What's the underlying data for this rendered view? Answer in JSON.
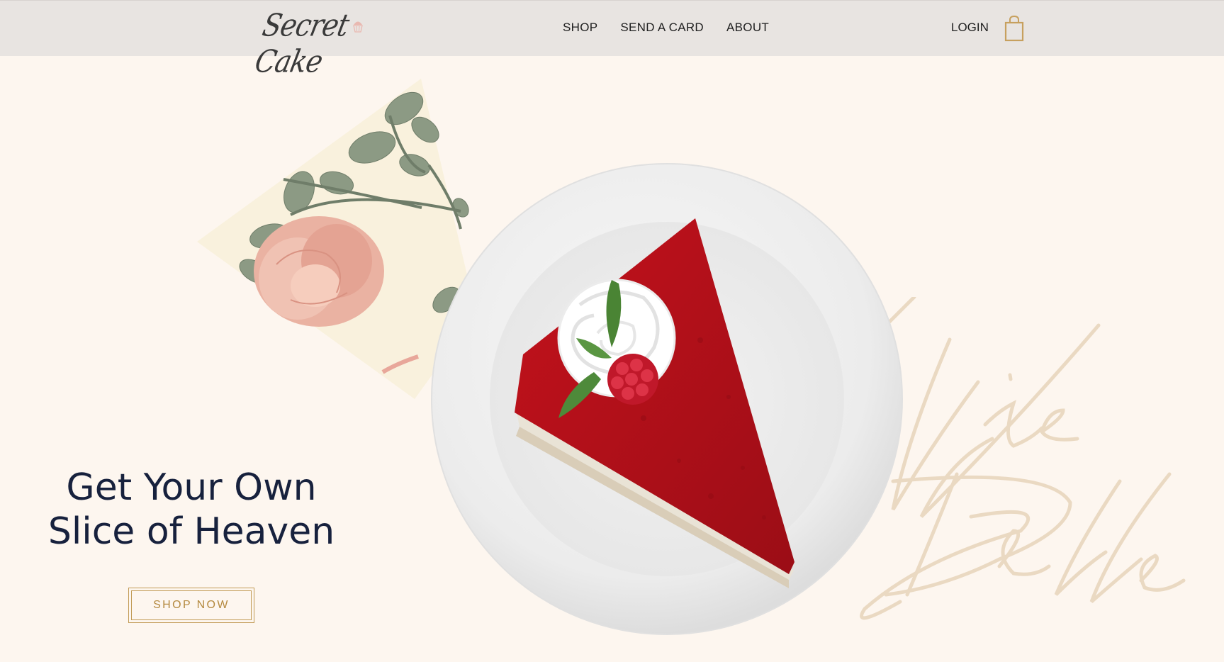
{
  "header": {
    "logo_text": "Secret Cake",
    "nav": [
      {
        "label": "SHOP"
      },
      {
        "label": "SEND A CARD"
      },
      {
        "label": "ABOUT"
      }
    ],
    "login_label": "LOGIN",
    "cart_icon": "shopping-bag-icon"
  },
  "hero": {
    "headline_line1": "Get Your Own",
    "headline_line2": "Slice of Heaven",
    "cta_label": "SHOP NOW",
    "background_script_text": "La Vie Belle"
  },
  "colors": {
    "header_bg": "#e8e4e1",
    "page_bg": "#fdf6ef",
    "headline": "#17213d",
    "accent_gold": "#c19a55",
    "cake_red": "#b5121b"
  }
}
